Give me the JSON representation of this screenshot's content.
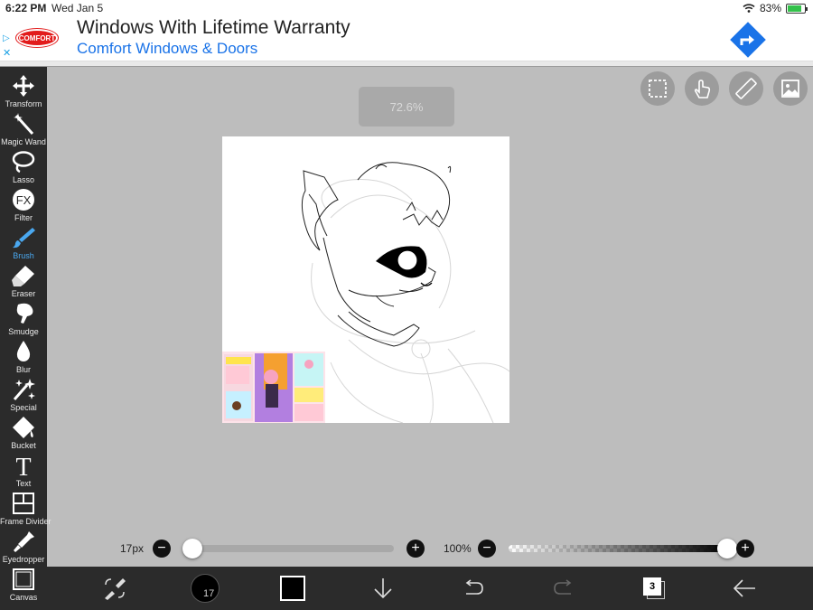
{
  "status_bar": {
    "time": "6:22 PM",
    "date": "Wed Jan 5",
    "battery": "83%",
    "battery_level": 0.83
  },
  "ad": {
    "logo_text": "COMFORT",
    "headline": "Windows With Lifetime Warranty",
    "advertiser": "Comfort Windows & Doors",
    "accent_color": "#1a73e8"
  },
  "toolbar": {
    "tools": [
      {
        "label": "Transform",
        "icon": "move-arrows-icon"
      },
      {
        "label": "Magic Wand",
        "icon": "magic-wand-icon"
      },
      {
        "label": "Lasso",
        "icon": "lasso-icon"
      },
      {
        "label": "Filter",
        "icon": "fx-icon",
        "glyph": "FX"
      },
      {
        "label": "Brush",
        "icon": "brush-icon",
        "active": true
      },
      {
        "label": "Eraser",
        "icon": "eraser-icon"
      },
      {
        "label": "Smudge",
        "icon": "smudge-icon"
      },
      {
        "label": "Blur",
        "icon": "droplet-icon"
      },
      {
        "label": "Special",
        "icon": "sparkle-icon"
      },
      {
        "label": "Bucket",
        "icon": "bucket-icon"
      },
      {
        "label": "Text",
        "icon": "text-icon",
        "glyph": "T"
      },
      {
        "label": "Frame Divider",
        "icon": "frame-divider-icon"
      },
      {
        "label": "Eyedropper",
        "icon": "eyedropper-icon"
      },
      {
        "label": "Canvas",
        "icon": "canvas-icon"
      }
    ],
    "active_color": "#4aa8f0"
  },
  "canvas": {
    "zoom_label": "72.6%"
  },
  "brush": {
    "size_label": "17px",
    "size_level": 0.02,
    "opacity_label": "100%",
    "opacity_level": 1.0,
    "minus": "−",
    "plus": "+"
  },
  "bottom_bar": {
    "brush_size_short": "17",
    "layer_count": "3",
    "icons": [
      "brush-eraser-swap-icon",
      "brush-size-icon",
      "color-swatch-icon",
      "save-down-arrow-icon",
      "undo-icon",
      "redo-icon",
      "layers-icon",
      "back-arrow-icon"
    ]
  },
  "top_right_buttons": [
    "selection-icon",
    "hand-gesture-icon",
    "ruler-icon",
    "image-icon"
  ]
}
